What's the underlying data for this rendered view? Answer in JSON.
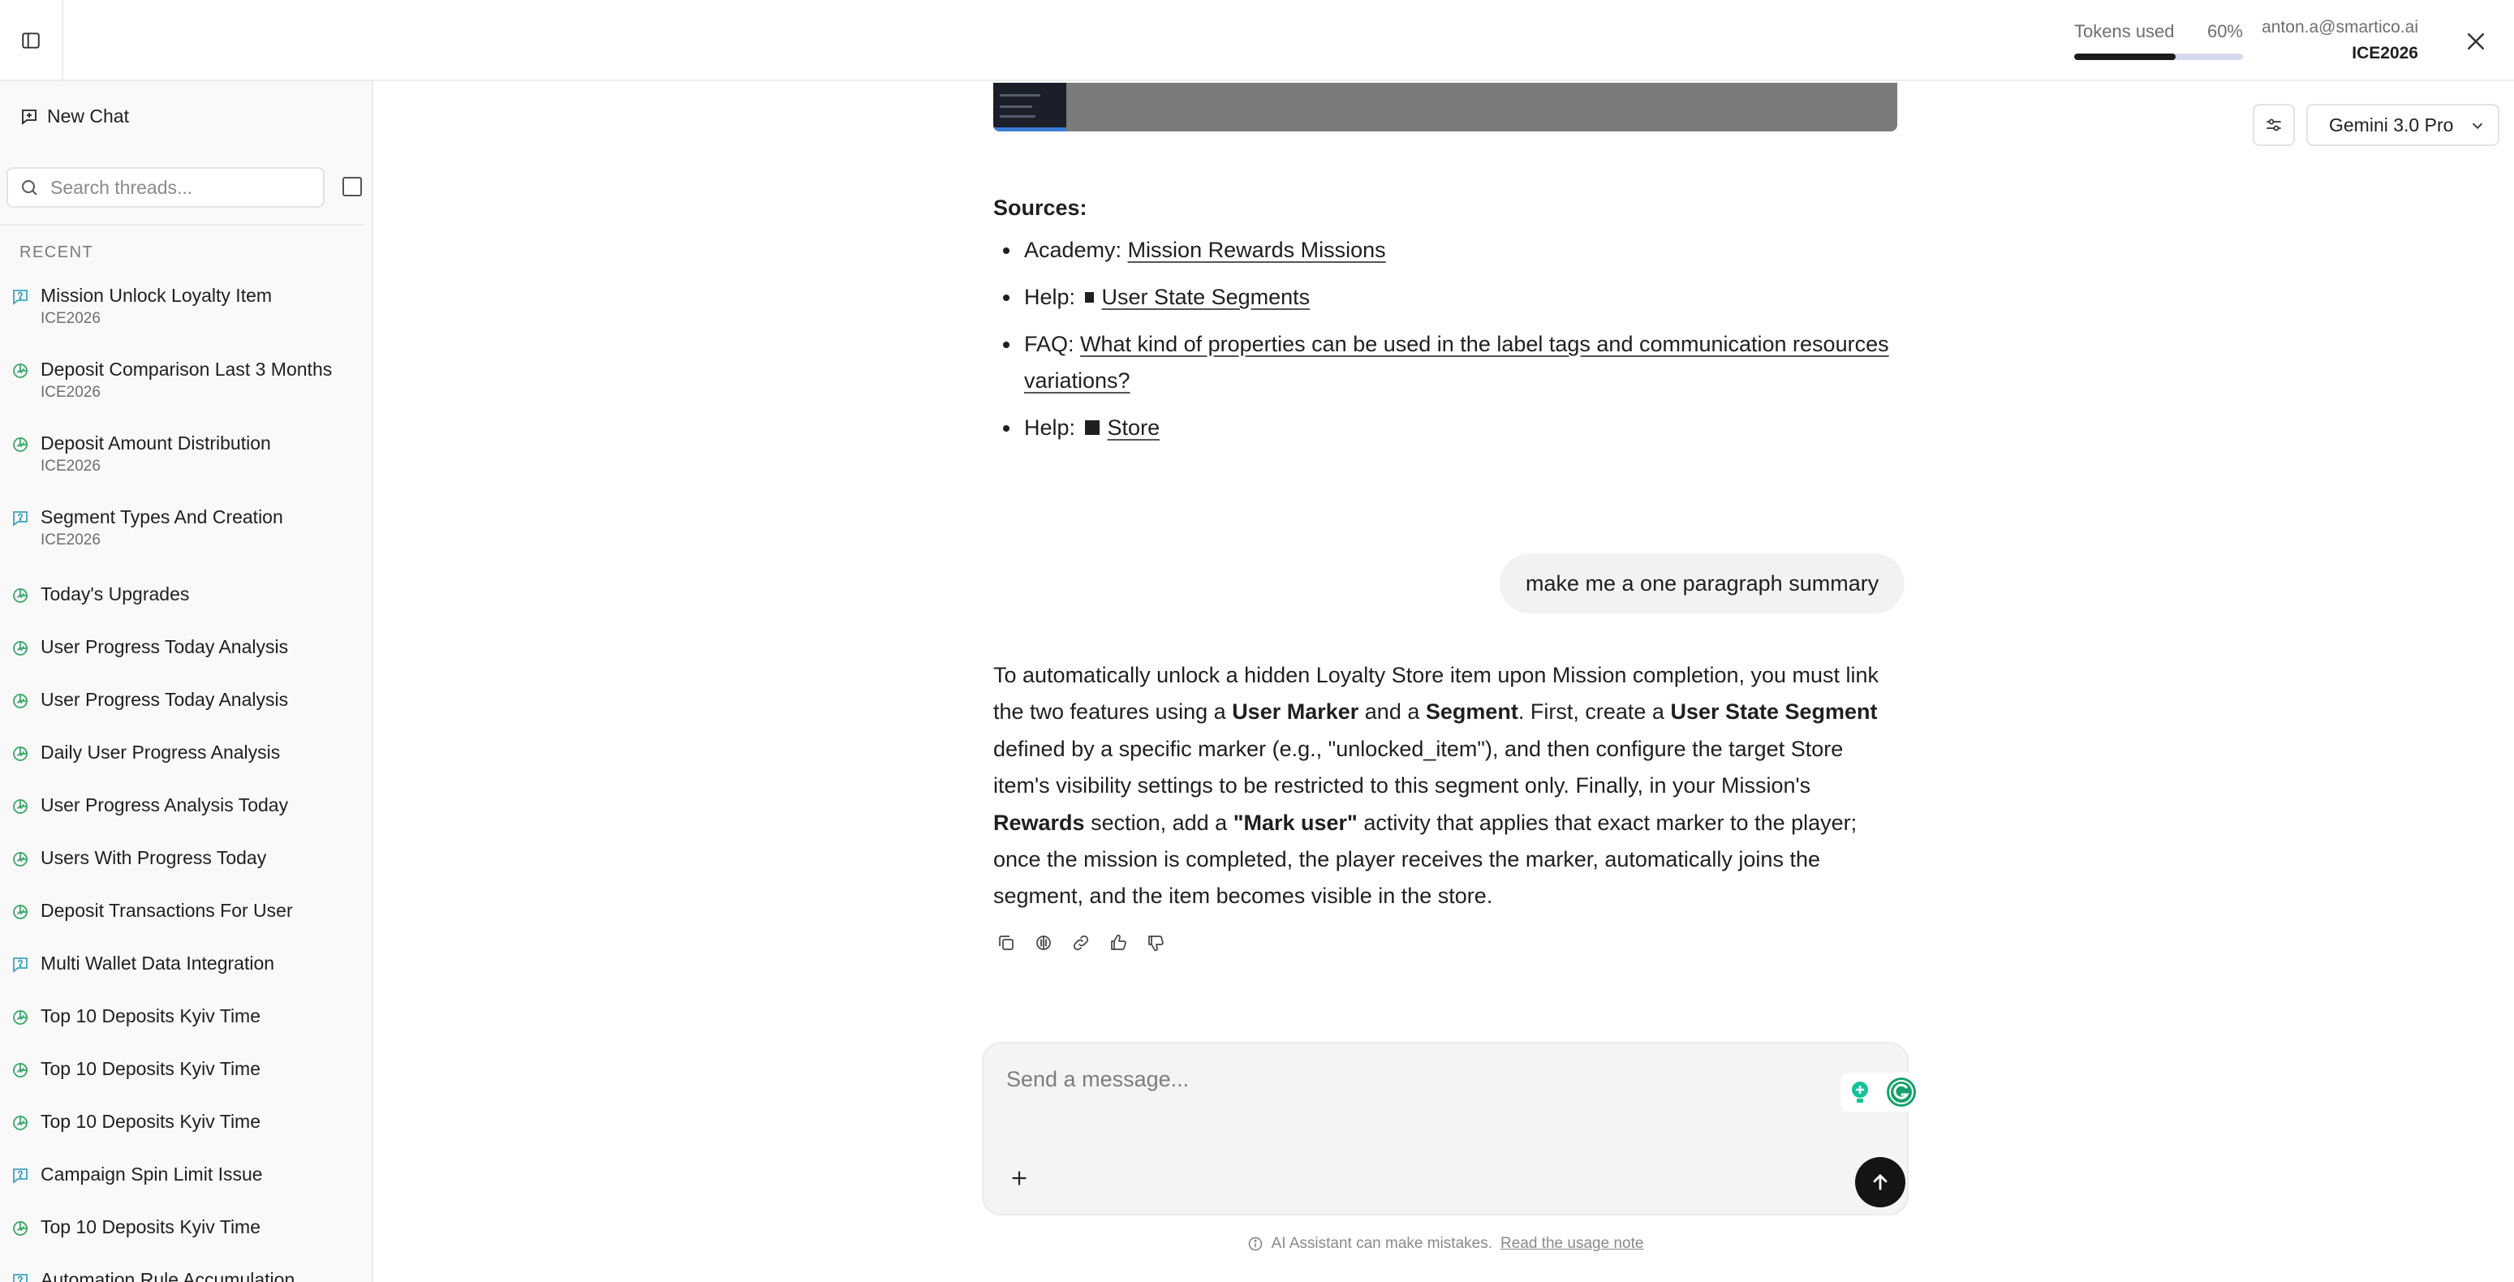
{
  "header": {
    "tokens_label": "Tokens used",
    "tokens_percent_text": "60%",
    "tokens_fraction": 0.6,
    "account_email": "anton.a@smartico.ai",
    "account_org": "ICE2026"
  },
  "sidebar": {
    "new_chat_label": "New Chat",
    "search_placeholder": "Search threads...",
    "recent_label": "RECENT",
    "threads": [
      {
        "title": "Mission Unlock Loyalty Item",
        "sub": "ICE2026",
        "icon": "help-icon"
      },
      {
        "title": "Deposit Comparison Last 3 Months",
        "sub": "ICE2026",
        "icon": "analytics-icon"
      },
      {
        "title": "Deposit Amount Distribution",
        "sub": "ICE2026",
        "icon": "analytics-icon"
      },
      {
        "title": "Segment Types And Creation",
        "sub": "ICE2026",
        "icon": "help-icon"
      },
      {
        "title": "Today's Upgrades",
        "sub": "",
        "icon": "analytics-icon"
      },
      {
        "title": "User Progress Today Analysis",
        "sub": "",
        "icon": "analytics-icon"
      },
      {
        "title": "User Progress Today Analysis",
        "sub": "",
        "icon": "analytics-icon"
      },
      {
        "title": "Daily User Progress Analysis",
        "sub": "",
        "icon": "analytics-icon"
      },
      {
        "title": "User Progress Analysis Today",
        "sub": "",
        "icon": "analytics-icon"
      },
      {
        "title": "Users With Progress Today",
        "sub": "",
        "icon": "analytics-icon"
      },
      {
        "title": "Deposit Transactions For User",
        "sub": "",
        "icon": "analytics-icon"
      },
      {
        "title": "Multi Wallet Data Integration",
        "sub": "",
        "icon": "help-icon"
      },
      {
        "title": "Top 10 Deposits Kyiv Time",
        "sub": "",
        "icon": "analytics-icon"
      },
      {
        "title": "Top 10 Deposits Kyiv Time",
        "sub": "",
        "icon": "analytics-icon"
      },
      {
        "title": "Top 10 Deposits Kyiv Time",
        "sub": "",
        "icon": "analytics-icon"
      },
      {
        "title": "Campaign Spin Limit Issue",
        "sub": "",
        "icon": "help-icon"
      },
      {
        "title": "Top 10 Deposits Kyiv Time",
        "sub": "",
        "icon": "analytics-icon"
      },
      {
        "title": "Automation Rule Accumulation",
        "sub": "",
        "icon": "help-icon"
      }
    ]
  },
  "toolbar": {
    "model_name": "Gemini 3.0 Pro"
  },
  "conversation": {
    "sources_title": "Sources:",
    "sources": [
      {
        "prefix": "Academy: ",
        "link": "Mission Rewards Missions",
        "marker": ""
      },
      {
        "prefix": "Help: ",
        "link": "User State Segments",
        "marker": "small"
      },
      {
        "prefix": "FAQ: ",
        "link": "What kind of properties can be used in the label tags and communication resources variations?",
        "marker": ""
      },
      {
        "prefix": "Help: ",
        "link": "Store",
        "marker": "big"
      }
    ],
    "user_message": "make me a one paragraph summary",
    "answer": {
      "t1": "To automatically unlock a hidden Loyalty Store item upon Mission completion, you must link the two features using a ",
      "b1": "User Marker",
      "t2": " and a ",
      "b2": "Segment",
      "t3": ". First, create a ",
      "b3": "User State Segment",
      "t4": " defined by a specific marker (e.g., \"unlocked_item\"), and then configure the target Store item's visibility settings to be restricted to this segment only. Finally, in your Mission's ",
      "b4": "Rewards",
      "t5": " section, add a ",
      "b5": "\"Mark user\"",
      "t6": " activity that applies that exact marker to the player; once the mission is completed, the player receives the marker, automatically joins the segment, and the item becomes visible in the store."
    }
  },
  "composer": {
    "placeholder": "Send a message..."
  },
  "footer": {
    "disclaimer": "AI Assistant can make mistakes.",
    "usage_link": "Read the usage note"
  }
}
